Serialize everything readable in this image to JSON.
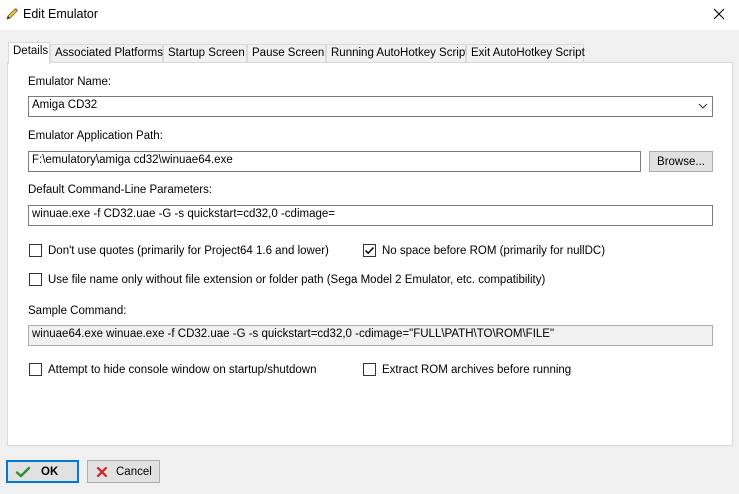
{
  "window": {
    "title": "Edit Emulator",
    "title_icon": "pencil-icon",
    "close_icon": "close-icon"
  },
  "tabs": [
    {
      "label": "Details",
      "active": true
    },
    {
      "label": "Associated Platforms",
      "active": false
    },
    {
      "label": "Startup Screen",
      "active": false
    },
    {
      "label": "Pause Screen",
      "active": false
    },
    {
      "label": "Running AutoHotkey Script",
      "active": false
    },
    {
      "label": "Exit AutoHotkey Script",
      "active": false
    }
  ],
  "details": {
    "emulator_name_label": "Emulator Name:",
    "emulator_name_value": "Amiga CD32",
    "app_path_label": "Emulator Application Path:",
    "app_path_value": "F:\\emulatory\\amiga cd32\\winuae64.exe",
    "browse_label": "Browse...",
    "cmdline_label": "Default Command-Line Parameters:",
    "cmdline_value": "winuae.exe -f CD32.uae -G -s quickstart=cd32,0 -cdimage=",
    "chk_no_quotes": {
      "label": "Don't use quotes (primarily for Project64 1.6 and lower)",
      "checked": false
    },
    "chk_no_space": {
      "label": "No space before ROM (primarily for nullDC)",
      "checked": true
    },
    "chk_filename_only": {
      "label": "Use file name only without file extension or folder path (Sega Model 2 Emulator, etc. compatibility)",
      "checked": false
    },
    "sample_label": "Sample Command:",
    "sample_value": "winuae64.exe winuae.exe -f CD32.uae -G -s quickstart=cd32,0 -cdimage=\"FULL\\PATH\\TO\\ROM\\FILE\"",
    "chk_hide_console": {
      "label": "Attempt to hide console window on startup/shutdown",
      "checked": false
    },
    "chk_extract_rom": {
      "label": "Extract ROM archives before running",
      "checked": false
    }
  },
  "footer": {
    "ok_label": "OK",
    "cancel_label": "Cancel"
  },
  "colors": {
    "accent": "#0078d7",
    "ok_check": "#2e8b2e",
    "cancel_x": "#d02020"
  }
}
